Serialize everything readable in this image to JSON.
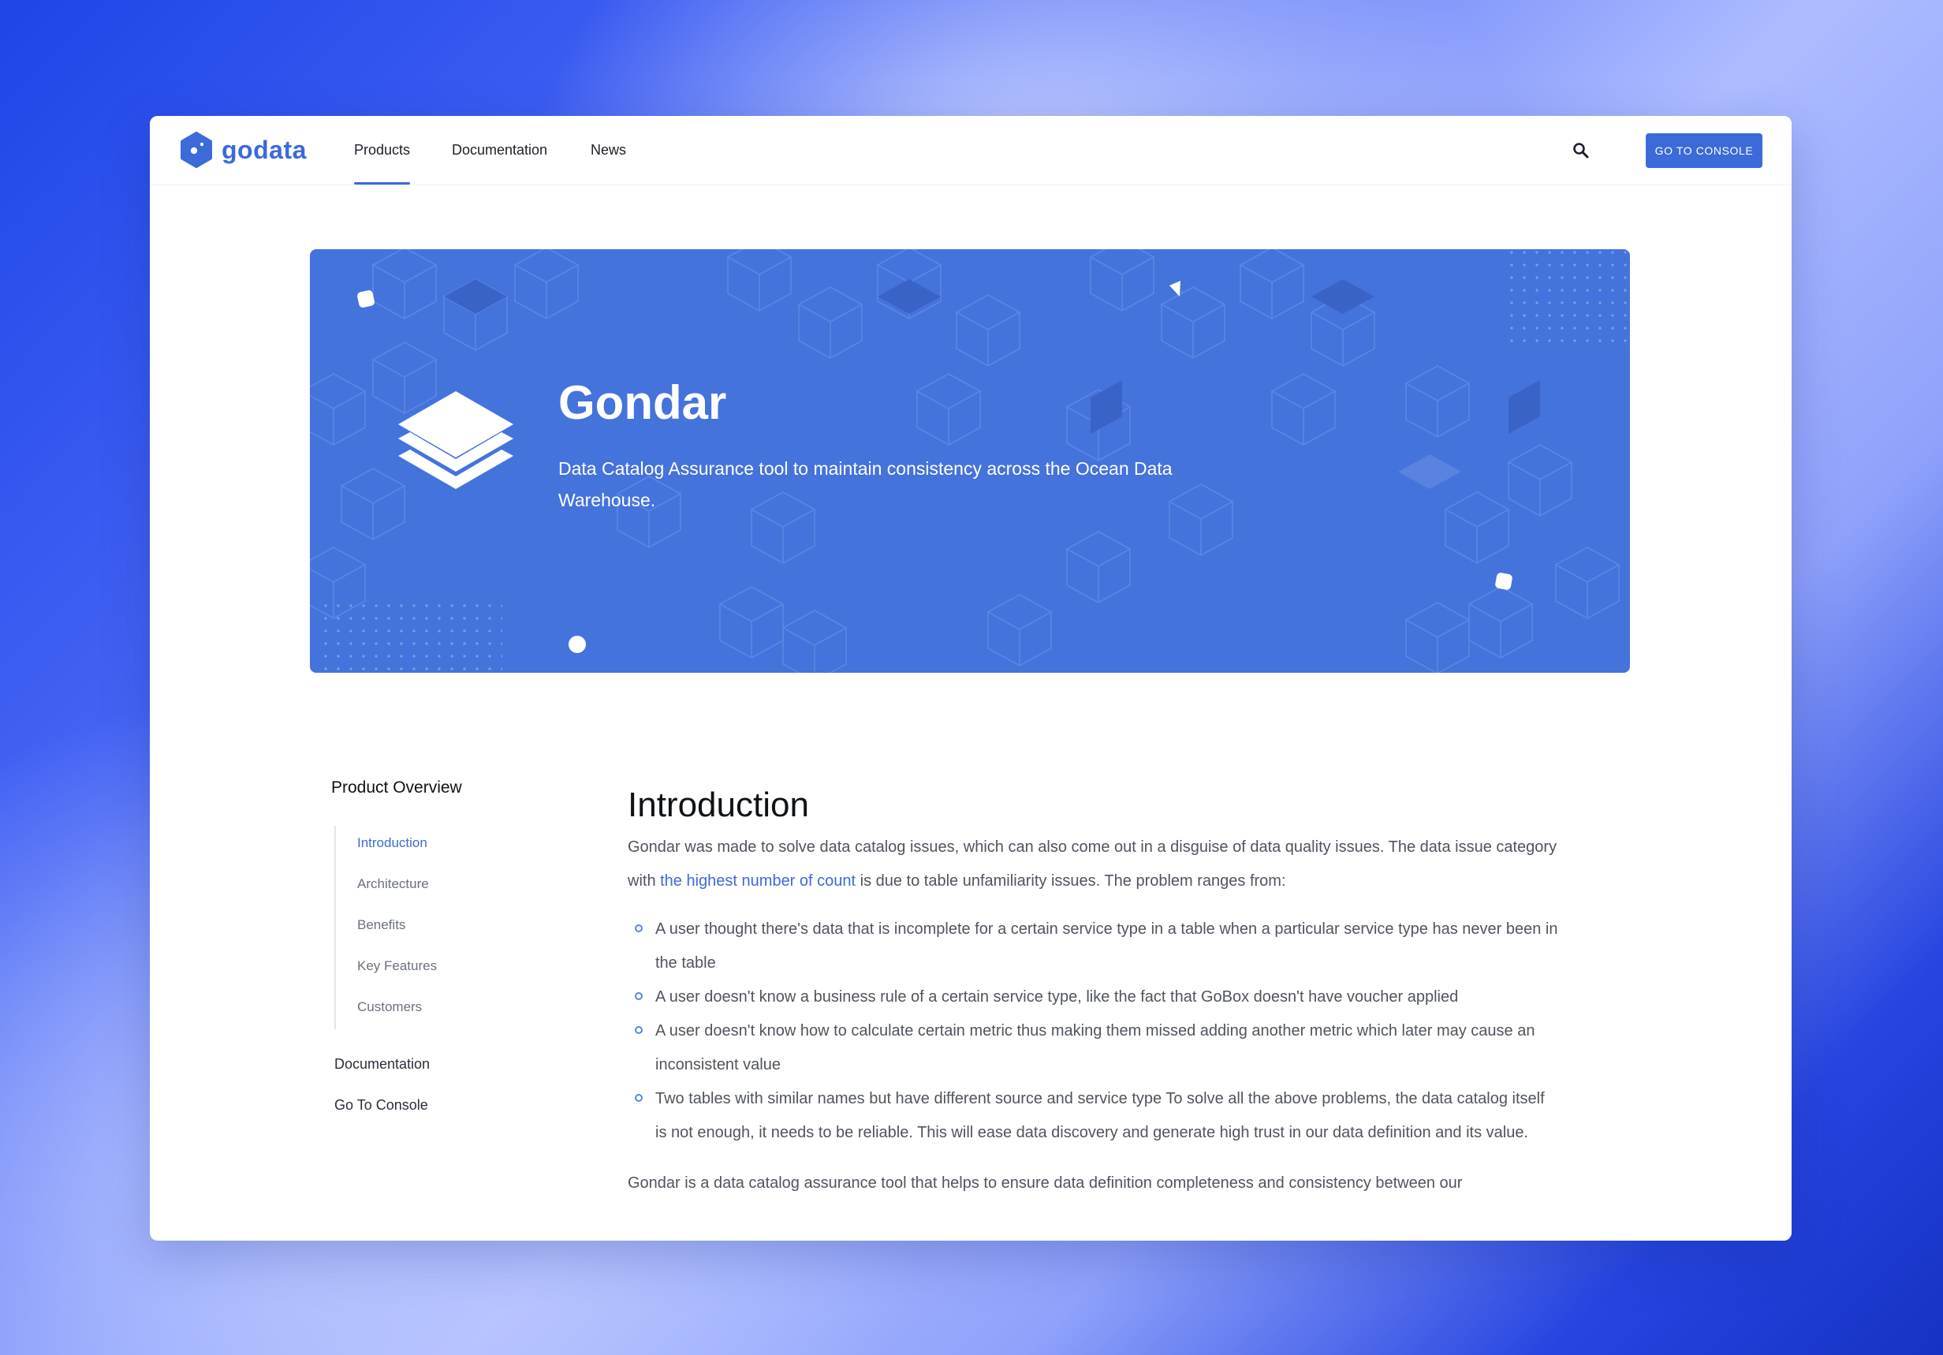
{
  "brand": {
    "name": "godata",
    "accent_color": "#3c6ad8"
  },
  "nav": {
    "items": [
      {
        "label": "Products",
        "active": true
      },
      {
        "label": "Documentation",
        "active": false
      },
      {
        "label": "News",
        "active": false
      }
    ],
    "search_icon": "search-icon",
    "console_button": "GO TO CONSOLE"
  },
  "hero": {
    "icon": "layers-icon",
    "title": "Gondar",
    "subtitle": "Data Catalog Assurance tool to maintain consistency across the Ocean Data Warehouse.",
    "background_color": "#4573dc"
  },
  "sidebar": {
    "heading": "Product Overview",
    "items": [
      {
        "label": "Introduction",
        "active": true
      },
      {
        "label": "Architecture",
        "active": false
      },
      {
        "label": "Benefits",
        "active": false
      },
      {
        "label": "Key Features",
        "active": false
      },
      {
        "label": "Customers",
        "active": false
      }
    ],
    "links": [
      {
        "label": "Documentation"
      },
      {
        "label": "Go To Console"
      }
    ]
  },
  "content": {
    "heading": "Introduction",
    "intro_before": "Gondar was made to solve data catalog issues, which can also come out in a disguise of data quality issues. The data issue category with ",
    "intro_link": "the highest number of count",
    "intro_after": " is due to table unfamiliarity issues. The problem ranges from:",
    "bullets": [
      "A user thought there's data that is incomplete for a certain service type in a table when a particular service type has never been in the table",
      "A user doesn't know a business rule of a certain service type, like the fact that GoBox doesn't have voucher applied",
      "A user doesn't know how to calculate certain metric thus making them missed adding another metric which later may cause an inconsistent value",
      "Two tables with similar names but have different source and service type To solve all the above problems, the data catalog itself is not enough, it needs to be reliable. This will ease data discovery and generate high trust in our data definition and its value."
    ],
    "closing": "Gondar is a data catalog assurance tool that helps to ensure data definition completeness and consistency between our"
  }
}
